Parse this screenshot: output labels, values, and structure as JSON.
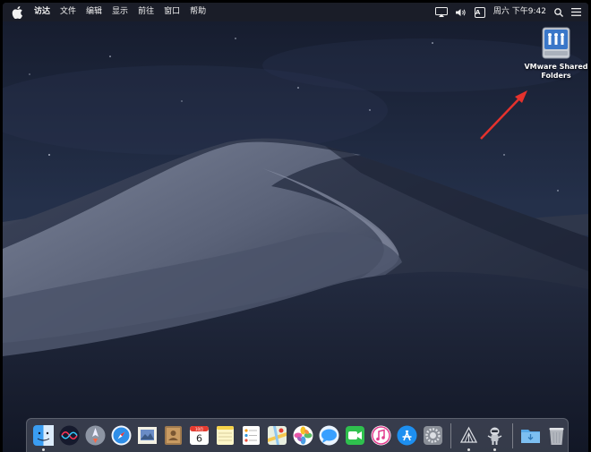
{
  "menubar": {
    "app_name": "访达",
    "menus": [
      "文件",
      "编辑",
      "显示",
      "前往",
      "窗口",
      "帮助"
    ],
    "input_method": "A",
    "clock": "周六 下午9:42"
  },
  "desktop": {
    "shared_folder_label": "VMware Shared Folders"
  },
  "dock": {
    "calendar_month": "10月",
    "calendar_day": "6",
    "apps": [
      "finder",
      "siri",
      "launchpad",
      "safari",
      "mail",
      "contacts",
      "calendar",
      "notes",
      "reminders",
      "maps",
      "photos",
      "messages",
      "facetime",
      "music",
      "app-store",
      "system-preferences",
      "vmware-tools",
      "automator",
      "downloads",
      "trash"
    ]
  },
  "colors": {
    "menubar_bg": "#1c1e26",
    "arrow": "#e5322d",
    "desktop_sky": "#1b2336"
  }
}
